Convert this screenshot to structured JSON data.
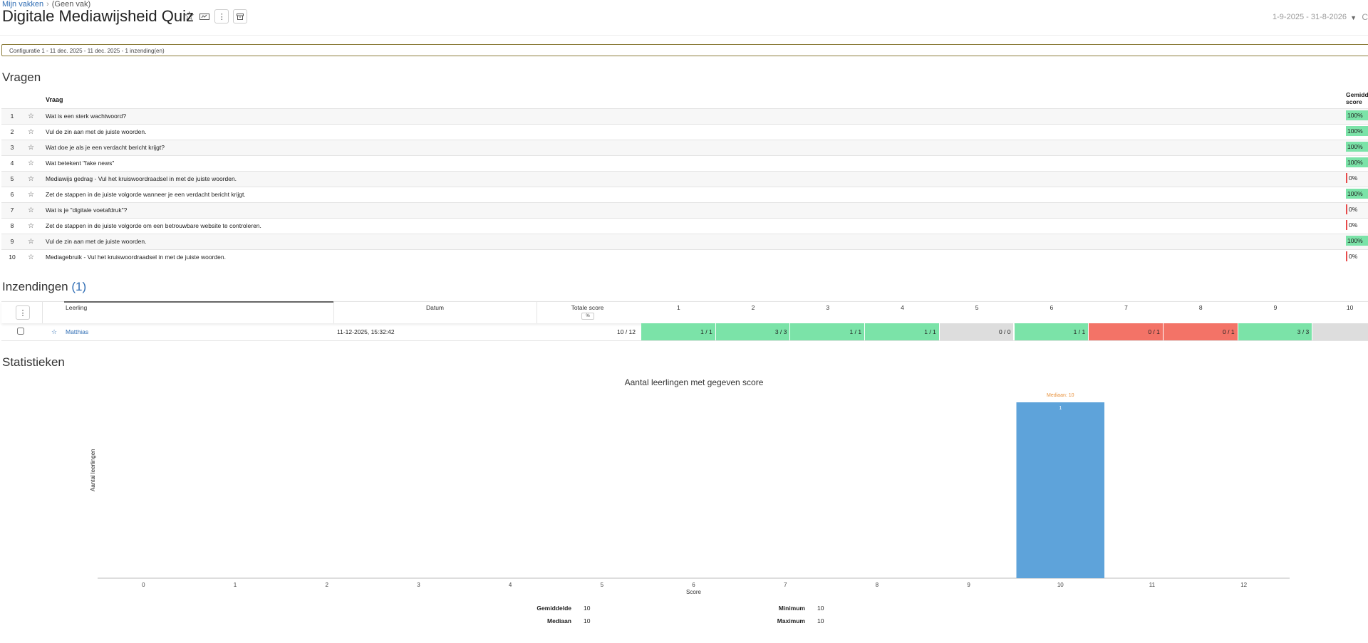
{
  "header": {
    "breadcrumb": [
      "Mijn vakken",
      "(Geen vak)"
    ],
    "title": "Digitale Mediawijsheid Quiz",
    "date_range": "1-9-2025 - 31-8-2026",
    "date_extra": "C"
  },
  "config_label": "Configuratie 1 - 11 dec. 2025 - 11 dec. 2025 - 1 inzending(en)",
  "questions": {
    "heading": "Vragen",
    "col_question": "Vraag",
    "col_avg": [
      "Gemidde",
      "score"
    ],
    "rows": [
      {
        "num": "1",
        "text": "Wat is een sterk wachtwoord?",
        "score": "100%"
      },
      {
        "num": "2",
        "text": "Vul de zin aan met de juiste woorden.",
        "score": "100%"
      },
      {
        "num": "3",
        "text": "Wat doe je als je een verdacht bericht krijgt?",
        "score": "100%"
      },
      {
        "num": "4",
        "text": "Wat betekent \"fake news\"",
        "score": "100%"
      },
      {
        "num": "5",
        "text": "Mediawijs gedrag - Vul het kruiswoordraadsel in met de juiste woorden.",
        "score": "0%"
      },
      {
        "num": "6",
        "text": "Zet de stappen in de juiste volgorde wanneer je een verdacht bericht krijgt.",
        "score": "100%"
      },
      {
        "num": "7",
        "text": "Wat is je \"digitale voetafdruk\"?",
        "score": "0%"
      },
      {
        "num": "8",
        "text": "Zet de stappen in de juiste volgorde om een betrouwbare website te controleren.",
        "score": "0%"
      },
      {
        "num": "9",
        "text": "Vul de zin aan met de juiste woorden.",
        "score": "100%"
      },
      {
        "num": "10",
        "text": "Mediagebruik - Vul het kruiswoordraadsel in met de juiste woorden.",
        "score": "0%"
      }
    ]
  },
  "submissions": {
    "heading": "Inzendingen",
    "count": "(1)",
    "col_student": "Leerling",
    "col_date": "Datum",
    "col_total": "Totale score",
    "total_toggle": "%",
    "question_cols": [
      "1",
      "2",
      "3",
      "4",
      "5",
      "6",
      "7",
      "8",
      "9",
      "10"
    ],
    "rows": [
      {
        "student": "Matthias",
        "date": "11-12-2025, 15:32:42",
        "total": "10 / 12",
        "scores": [
          "1 / 1",
          "3 / 3",
          "1 / 1",
          "1 / 1",
          "0 / 0",
          "1 / 1",
          "0 / 1",
          "0 / 1",
          "3 / 3",
          ""
        ],
        "states": [
          "g",
          "g",
          "g",
          "g",
          "n",
          "g",
          "r",
          "r",
          "g",
          "n"
        ]
      }
    ]
  },
  "statistics": {
    "heading": "Statistieken",
    "summary": {
      "avg_label": "Gemiddelde",
      "avg": "10",
      "median_label": "Mediaan",
      "median": "10",
      "min_label": "Minimum",
      "min": "10",
      "max_label": "Maximum",
      "max": "10"
    }
  },
  "chart_data": {
    "type": "bar",
    "title": "Aantal leerlingen met gegeven score",
    "xlabel": "Score",
    "ylabel": "Aantal leerlingen",
    "categories": [
      "0",
      "1",
      "2",
      "3",
      "4",
      "5",
      "6",
      "7",
      "8",
      "9",
      "10",
      "11",
      "12"
    ],
    "values": [
      0,
      0,
      0,
      0,
      0,
      0,
      0,
      0,
      0,
      0,
      1,
      0,
      0
    ],
    "data_label": "1",
    "median_annotation": "Mediaan: 10",
    "ylim": [
      0,
      1
    ],
    "colors": {
      "bar": "#5ea3da",
      "median": "#e8903a"
    }
  }
}
